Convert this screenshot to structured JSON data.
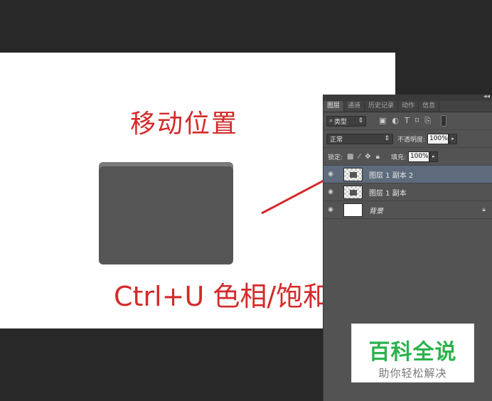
{
  "canvas": {
    "title_annotation": "移动位置",
    "command_annotation": "Ctrl+U  色相/饱和度",
    "annotation_color": "#d42a2a",
    "shape_color": "#555555"
  },
  "layers_panel": {
    "tabs": [
      "图层",
      "通道",
      "历史记录",
      "动作",
      "信息"
    ],
    "filter": {
      "label": "类型",
      "icon": "search-icon"
    },
    "blend_mode": "正常",
    "opacity_label": "不透明度:",
    "opacity_value": "100%",
    "lock_label": "锁定:",
    "fill_label": "填充:",
    "fill_value": "100%",
    "layers": [
      {
        "name": "图层 1 副本 2",
        "selected": true
      },
      {
        "name": "图层 1 副本",
        "selected": false
      },
      {
        "name": "背景",
        "selected": false,
        "locked": true
      }
    ]
  },
  "watermark": {
    "main": "百科全说",
    "sub": "助你轻松解决",
    "color": "#2bb24c"
  }
}
